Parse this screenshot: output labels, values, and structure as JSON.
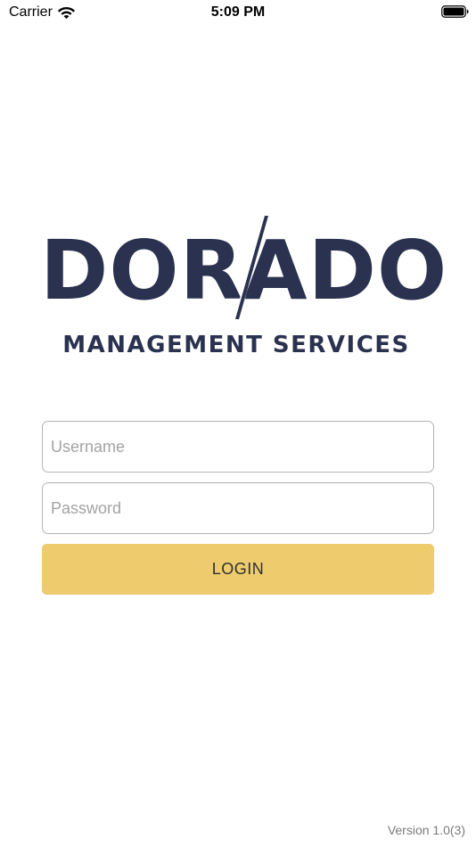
{
  "status_bar": {
    "carrier": "Carrier",
    "time": "5:09 PM",
    "wifi_icon": "wifi-icon",
    "battery_icon": "battery-icon"
  },
  "logo": {
    "wordmark": "DORADO",
    "subtitle": "MANAGEMENT SERVICES",
    "color": "#2a3250"
  },
  "login_form": {
    "username_placeholder": "Username",
    "username_value": "",
    "password_placeholder": "Password",
    "password_value": "",
    "login_label": "LOGIN",
    "login_color": "#eecc6e"
  },
  "footer": {
    "version": "Version 1.0(3)"
  }
}
